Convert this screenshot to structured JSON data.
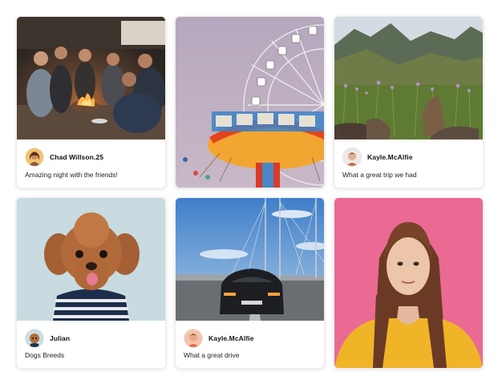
{
  "cards": [
    {
      "author": "Chad Willson.25",
      "caption": "Amazing night with the friends!",
      "photo": "friends-campfire-photo"
    },
    {
      "author": "",
      "caption": "",
      "photo": "ferris-wheel-carousel-photo"
    },
    {
      "author": "Kayle.McAlfie",
      "caption": "What a great trip we had",
      "photo": "mountain-meadow-photo"
    },
    {
      "author": "Julian",
      "caption": "Dogs Breeds",
      "photo": "poodle-dog-photo"
    },
    {
      "author": "Kayle.McAlfie",
      "caption": "What a great drive",
      "photo": "car-on-bridge-photo"
    },
    {
      "author": "",
      "caption": "",
      "photo": "woman-portrait-photo"
    }
  ],
  "colors": {
    "background": "#ffffff",
    "card_border": "#eeeeee",
    "pink_backdrop": "#ea6a93",
    "sweater_yellow": "#f0b428"
  }
}
